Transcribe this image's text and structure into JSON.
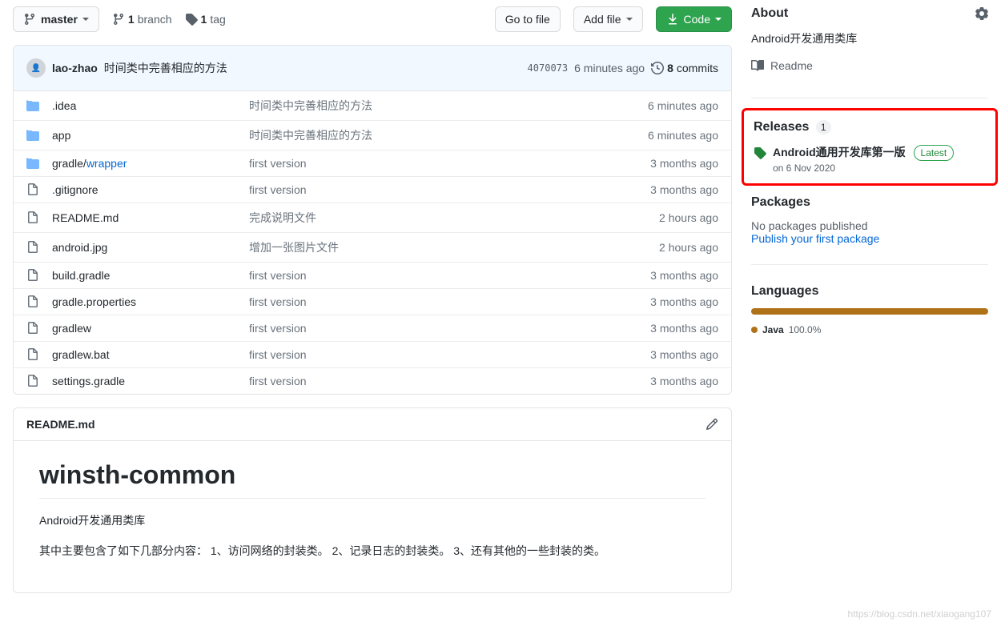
{
  "topbar": {
    "branch": "master",
    "branches_count": "1",
    "branches_label": "branch",
    "tags_count": "1",
    "tags_label": "tag",
    "go_to_file": "Go to file",
    "add_file": "Add file",
    "code": "Code"
  },
  "commit_header": {
    "author": "lao-zhao",
    "message": "时间类中完善相应的方法",
    "sha": "4070073",
    "time": "6 minutes ago",
    "commits_count": "8",
    "commits_label": "commits"
  },
  "files": [
    {
      "type": "dir",
      "name": ".idea",
      "msg": "时间类中完善相应的方法",
      "time": "6 minutes ago"
    },
    {
      "type": "dir",
      "name": "app",
      "msg": "时间类中完善相应的方法",
      "time": "6 minutes ago"
    },
    {
      "type": "dir",
      "name": "gradle/",
      "subpath": "wrapper",
      "msg": "first version",
      "time": "3 months ago"
    },
    {
      "type": "file",
      "name": ".gitignore",
      "msg": "first version",
      "time": "3 months ago"
    },
    {
      "type": "file",
      "name": "README.md",
      "msg": "完成说明文件",
      "time": "2 hours ago"
    },
    {
      "type": "file",
      "name": "android.jpg",
      "msg": "增加一张图片文件",
      "time": "2 hours ago"
    },
    {
      "type": "file",
      "name": "build.gradle",
      "msg": "first version",
      "time": "3 months ago"
    },
    {
      "type": "file",
      "name": "gradle.properties",
      "msg": "first version",
      "time": "3 months ago"
    },
    {
      "type": "file",
      "name": "gradlew",
      "msg": "first version",
      "time": "3 months ago"
    },
    {
      "type": "file",
      "name": "gradlew.bat",
      "msg": "first version",
      "time": "3 months ago"
    },
    {
      "type": "file",
      "name": "settings.gradle",
      "msg": "first version",
      "time": "3 months ago"
    }
  ],
  "readme": {
    "filename": "README.md",
    "h1": "winsth-common",
    "p1": "Android开发通用类库",
    "p2": "其中主要包含了如下几部分内容： 1、访问网络的封装类。 2、记录日志的封装类。 3、还有其他的一些封装的类。"
  },
  "about": {
    "heading": "About",
    "description": "Android开发通用类库",
    "readme_link": "Readme"
  },
  "releases": {
    "heading": "Releases",
    "count": "1",
    "title": "Android通用开发库第一版",
    "latest": "Latest",
    "date": "on 6 Nov 2020"
  },
  "packages": {
    "heading": "Packages",
    "none": "No packages published",
    "publish": "Publish your first package"
  },
  "languages": {
    "heading": "Languages",
    "lang": "Java",
    "pct": "100.0%"
  },
  "watermark": "https://blog.csdn.net/xiaogang107"
}
